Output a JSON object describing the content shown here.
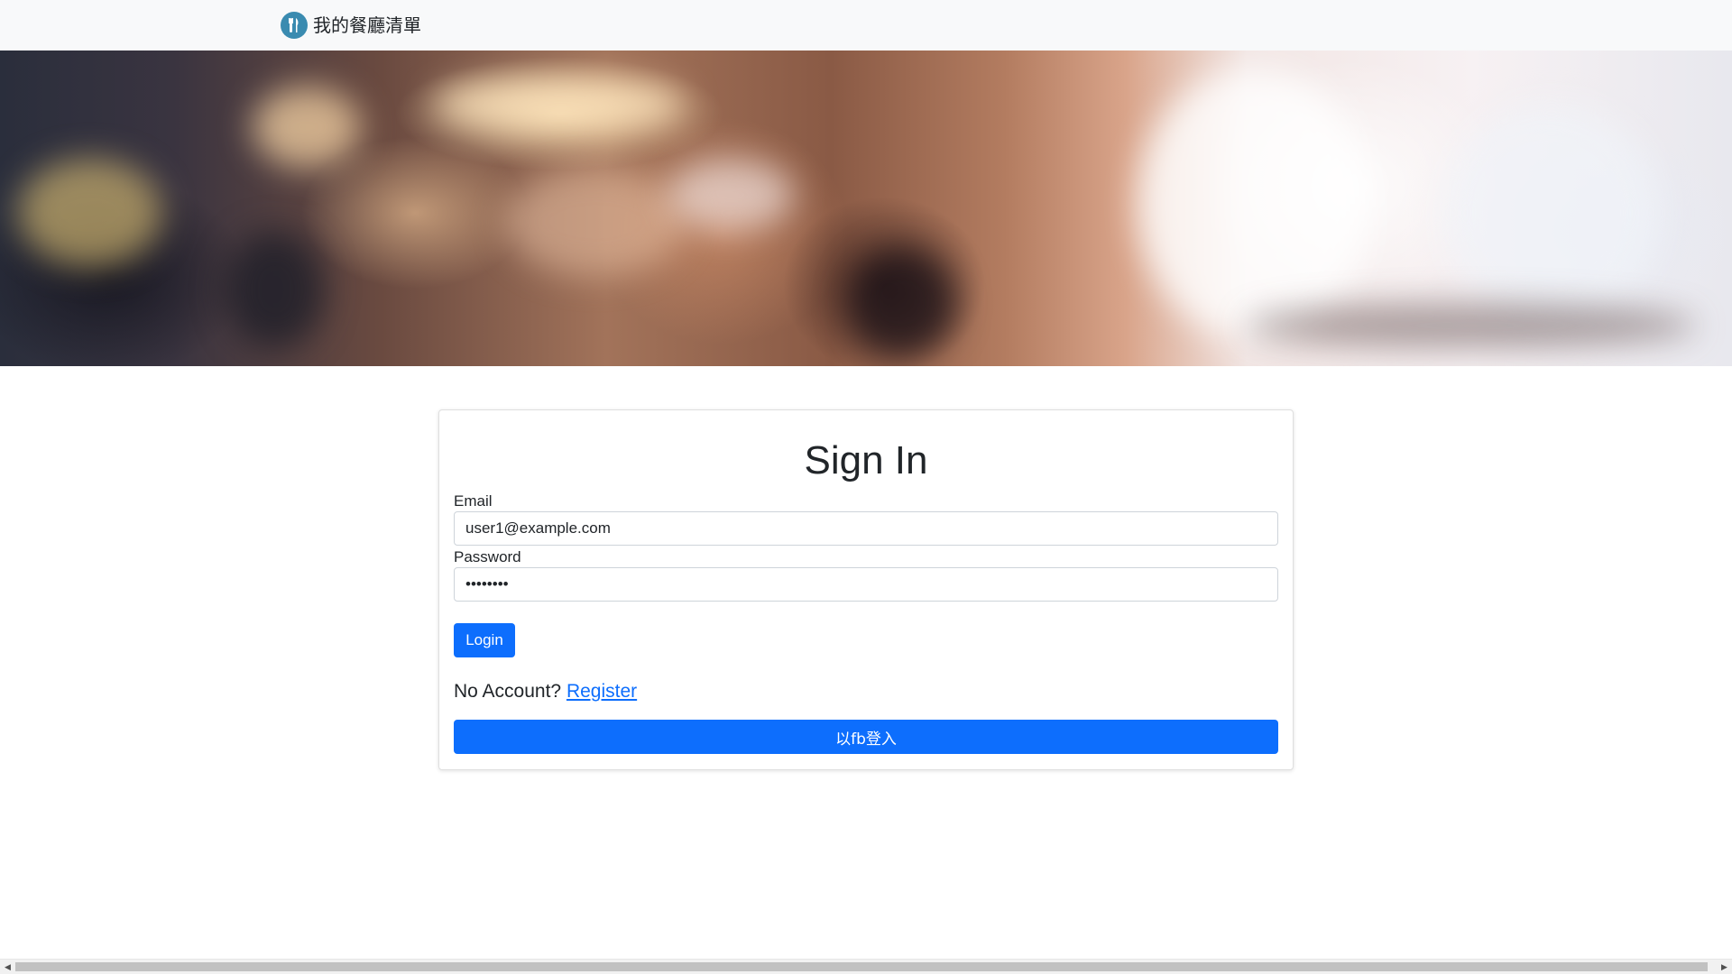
{
  "navbar": {
    "brand_text": "我的餐廳清單",
    "brand_icon": "fork-knife-icon"
  },
  "banner": {
    "image": "blurred-restaurant-interior"
  },
  "signin": {
    "title": "Sign In",
    "email_label": "Email",
    "email_value": "user1@example.com",
    "password_label": "Password",
    "password_value": "••••••••",
    "login_button": "Login",
    "no_account_text": "No Account?",
    "register_link": "Register",
    "fb_button": "以fb登入"
  },
  "colors": {
    "primary": "#0d6efd",
    "navbar_bg": "#f8f9fa",
    "logo_bg": "#3a8bb0"
  },
  "scrollbar": {
    "left_arrow_icon": "triangle-left-icon",
    "right_arrow_icon": "triangle-right-icon"
  }
}
